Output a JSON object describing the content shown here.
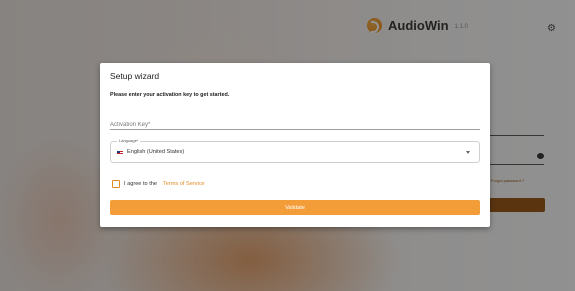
{
  "app": {
    "name": "AudioWin",
    "version": "1.1.0"
  },
  "background": {
    "forgot_password": "Forgot password ?"
  },
  "modal": {
    "title": "Setup wizard",
    "subtitle": "Please enter your activation key to get started.",
    "activation_placeholder": "Activation Key*",
    "language": {
      "label": "Language*",
      "value": "English (United States)",
      "flag_icon": "us-flag-icon"
    },
    "terms": {
      "text": "I agree to the",
      "link": "Terms of Service"
    },
    "validate_label": "Validate"
  },
  "colors": {
    "accent": "#f29d38",
    "link": "#e38d27"
  }
}
